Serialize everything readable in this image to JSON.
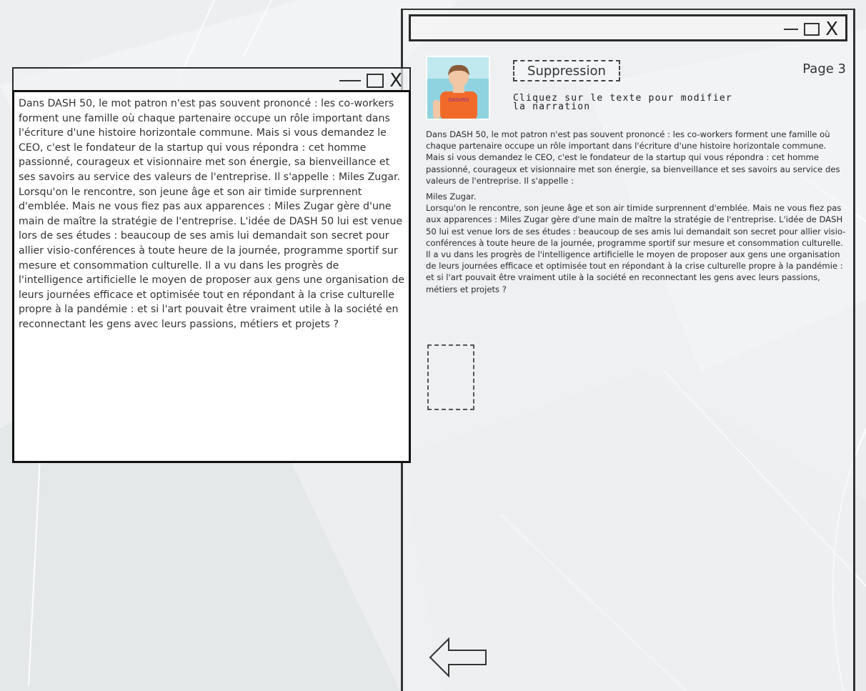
{
  "window_controls": {
    "minimize": "—",
    "maximize": "☐",
    "close": "X"
  },
  "editor": {
    "text": "Dans DASH 50, le mot patron n'est pas souvent prononcé : les co-workers forment une famille où chaque partenaire occupe un rôle important dans l'écriture d'une histoire horizontale commune. Mais si vous demandez le CEO, c'est le fondateur de la startup qui vous répondra : cet homme passionné, courageux et visionnaire met son énergie, sa bienveillance et ses savoirs au service des valeurs de l'entreprise. Il s'appelle : Miles Zugar.\nLorsqu'on le rencontre, son jeune âge et son air timide surprennent d'emblée. Mais ne vous fiez pas aux apparences : Miles Zugar gère d'une main de maître la stratégie de l'entreprise. L'idée de DASH 50 lui est venue lors de ses études : beaucoup de ses amis lui demandait son secret pour allier visio-conférences à toute heure de la journée, programme sportif sur mesure et consommation culturelle. Il a vu dans les progrès de l'intelligence artificielle le moyen de proposer aux gens une organisation de leurs journées efficace et optimisée tout en répondant à la crise culturelle propre à la pandémie : et si l'art pouvait être vraiment utile à la société en reconnectant les gens avec leurs passions, métiers et projets ?"
  },
  "page": {
    "delete_button_label": "Suppression",
    "page_label": "Page 3",
    "hint": "Cliquez sur le texte pour modifier\nla narration",
    "narration": {
      "p1": "Dans DASH 50, le mot patron n'est pas souvent prononcé : les co-workers forment une famille où chaque partenaire occupe un rôle important dans l'écriture d'une histoire horizontale commune. Mais si vous demandez le CEO, c'est le fondateur de la startup qui vous répondra : cet homme passionné, courageux et visionnaire met son énergie, sa bienveillance et ses savoirs au service des valeurs de l'entreprise. Il s'appelle :",
      "p2": "Miles Zugar.",
      "p3": "Lorsqu'on le rencontre, son jeune âge et son air timide surprennent d'emblée. Mais ne vous fiez pas aux apparences : Miles Zugar gère d'une main de maître la stratégie de l'entreprise. L'idée de DASH 50 lui est venue lors de ses études : beaucoup de ses amis lui demandait son secret pour allier visio-conférences à toute heure de la journée, programme sportif sur mesure et consommation culturelle. Il a vu dans les progrès de l'intelligence artificielle le moyen de proposer aux gens une organisation de leurs journées efficace et optimisée tout en répondant à la crise culturelle propre à la pandémie : et si l'art pouvait être vraiment utile à la société en reconnectant les gens avec leurs passions, métiers et projets ?"
    },
    "avatar_shirt_text": "DASH50"
  },
  "colors": {
    "background": "#eceeef",
    "shirt": "#f26a2a",
    "avatar_bg": "#8fd3e0"
  },
  "icons": {
    "back": "arrow-left-outline-icon",
    "image_placeholder": "image-placeholder-icon"
  }
}
